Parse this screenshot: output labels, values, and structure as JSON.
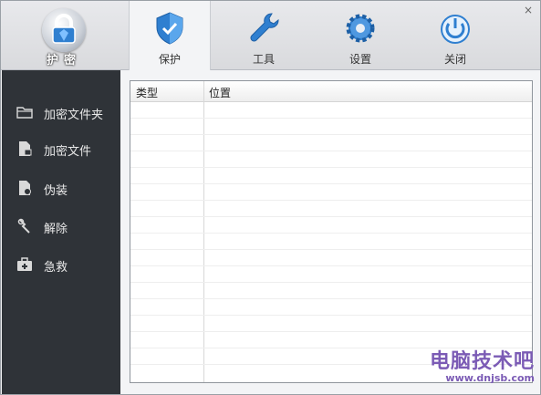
{
  "logo": {
    "text": "护密"
  },
  "nav": [
    {
      "label": "保护",
      "icon": "shield-icon",
      "active": true
    },
    {
      "label": "工具",
      "icon": "wrench-icon",
      "active": false
    },
    {
      "label": "设置",
      "icon": "gear-icon",
      "active": false
    },
    {
      "label": "关闭",
      "icon": "power-icon",
      "active": false
    }
  ],
  "window": {
    "close": "×"
  },
  "sidebar": {
    "items": [
      {
        "label": "加密文件夹",
        "icon": "folder-icon"
      },
      {
        "label": "加密文件",
        "icon": "file-lock-icon"
      },
      {
        "label": "伪装",
        "icon": "disguise-icon"
      },
      {
        "label": "解除",
        "icon": "unlock-icon"
      },
      {
        "label": "急救",
        "icon": "first-aid-icon"
      }
    ]
  },
  "table": {
    "columns": [
      "类型",
      "位置"
    ],
    "rows": []
  },
  "watermark": {
    "text": "电脑技术吧",
    "url": "www.dnjsb.com"
  },
  "colors": {
    "sidebar": "#2f3338",
    "accent": "#2f7fd0",
    "watermark": "#7b5bb5"
  }
}
